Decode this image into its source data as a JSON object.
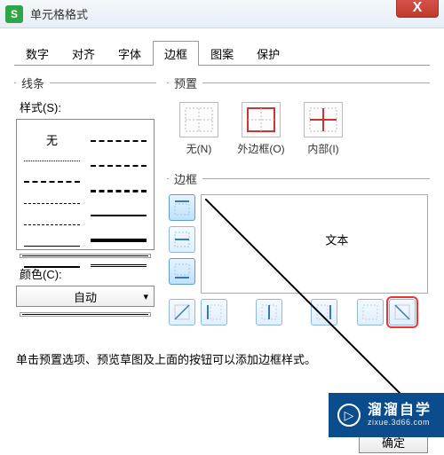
{
  "window": {
    "app_icon_letter": "S",
    "title": "单元格格式",
    "close_glyph": "X"
  },
  "tabs": [
    {
      "label": "数字"
    },
    {
      "label": "对齐"
    },
    {
      "label": "字体"
    },
    {
      "label": "边框",
      "active": true
    },
    {
      "label": "图案"
    },
    {
      "label": "保护"
    }
  ],
  "line": {
    "group_label": "线条",
    "style_label": "样式(S):",
    "none_label": "无",
    "color_label": "颜色(C):",
    "color_value": "自动"
  },
  "presets": {
    "group_label": "预置",
    "items": [
      {
        "label": "无(N)"
      },
      {
        "label": "外边框(O)"
      },
      {
        "label": "内部(I)"
      }
    ]
  },
  "border": {
    "group_label": "边框",
    "preview_text": "文本",
    "side_buttons": [
      "top",
      "horizontal-mid",
      "bottom"
    ],
    "bottom_buttons": [
      "diag-up",
      "left",
      "vertical-mid",
      "right",
      "none",
      "diag-down"
    ],
    "highlighted_index": 5
  },
  "hint": "单击预置选项、预览草图及上面的按钮可以添加边框样式。",
  "footer": {
    "ok": "确定"
  },
  "watermark": {
    "main": "溜溜自学",
    "sub": "zixue.3d66.com",
    "play": "▷"
  }
}
